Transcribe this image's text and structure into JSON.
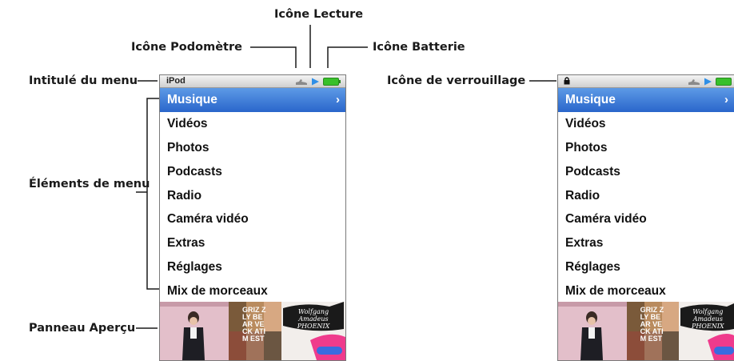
{
  "callouts": {
    "lecture": "Icône Lecture",
    "podometre": "Icône Podomètre",
    "batterie": "Icône Batterie",
    "intitule": "Intitulé du menu",
    "verrouillage": "Icône de verrouillage",
    "elements": "Éléments de menu",
    "apercu": "Panneau Aperçu"
  },
  "screen": {
    "title": "iPod",
    "menu": [
      "Musique",
      "Vidéos",
      "Photos",
      "Podcasts",
      "Radio",
      "Caméra vidéo",
      "Extras",
      "Réglages",
      "Mix de morceaux"
    ],
    "selected_chevron": "›"
  },
  "album_art": {
    "album2_text": "GRIZ ZLY BEAR VECK ATIM EST",
    "album3_text": "Wolfgang Amadeus PHOENIX"
  },
  "colors": {
    "selection": "#2a66cb",
    "battery": "#38c02a",
    "play": "#2f8fe6"
  }
}
